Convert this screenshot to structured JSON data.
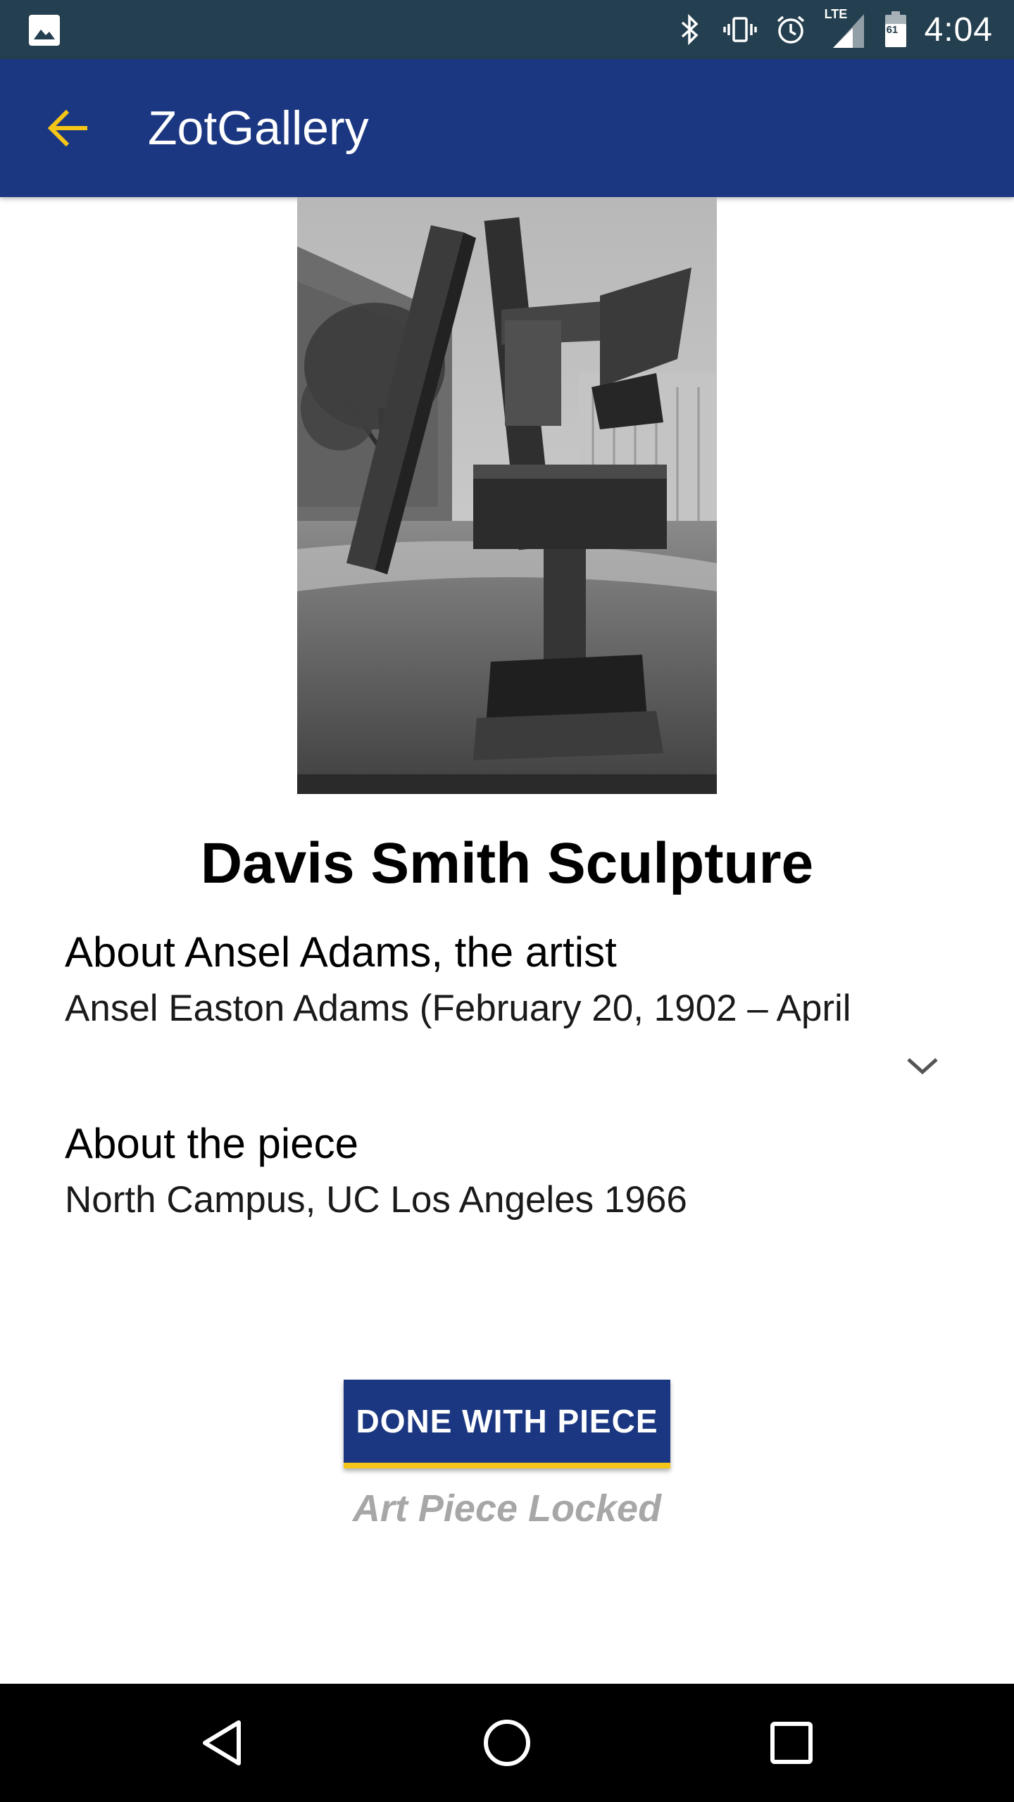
{
  "status_bar": {
    "time": "4:04",
    "icons": [
      "image-notification-icon",
      "bluetooth-icon",
      "vibrate-icon",
      "alarm-icon",
      "lte-signal-icon",
      "battery-icon"
    ],
    "network_label": "LTE",
    "battery_label": "61"
  },
  "app_bar": {
    "title": "ZotGallery",
    "back_icon": "arrow-left-icon",
    "accent_color": "#f5c518",
    "bar_color": "#1c3781"
  },
  "artwork": {
    "title": "Davis Smith Sculpture"
  },
  "artist_section": {
    "heading": "About Ansel Adams, the artist",
    "body": "Ansel Easton Adams (February 20, 1902 – April"
  },
  "piece_section": {
    "heading": "About the piece",
    "body": "North Campus, UC Los Angeles 1966"
  },
  "actions": {
    "done_label": "DONE WITH PIECE",
    "status_label": "Art Piece Locked"
  },
  "nav_bar": {
    "icons": [
      "back-triangle-icon",
      "home-circle-icon",
      "recents-square-icon"
    ]
  }
}
